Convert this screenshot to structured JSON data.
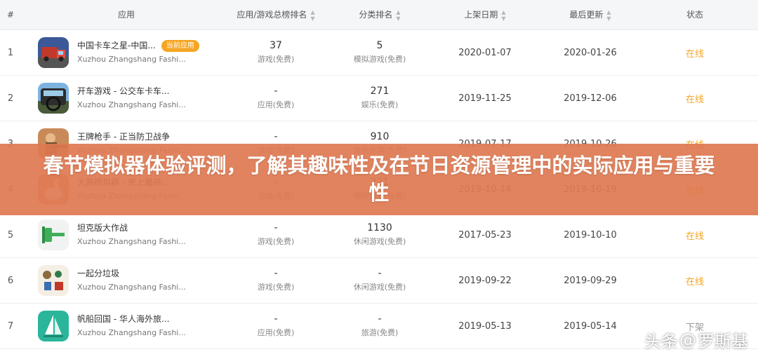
{
  "table": {
    "headers": {
      "rank": "#",
      "app": "应用",
      "total_rank": "应用/游戏总榜排名",
      "category_rank": "分类排名",
      "launch_date": "上架日期",
      "last_update": "最后更新",
      "status": "状态"
    },
    "rows": [
      {
        "rank": "1",
        "name": "中国卡车之星-中国...",
        "badge": "当前应用",
        "developer": "Xuzhou Zhangshang Fashi...",
        "total": "37",
        "total_sub": "游戏(免费)",
        "cat": "5",
        "cat_sub": "模拟游戏(免费)",
        "launch": "2020-01-07",
        "update": "2020-01-26",
        "status": "在线",
        "icon": "truck-game-icon"
      },
      {
        "rank": "2",
        "name": "开车游戏 - 公交车卡车...",
        "developer": "Xuzhou Zhangshang Fashi...",
        "total": "-",
        "total_sub": "应用(免费)",
        "cat": "271",
        "cat_sub": "娱乐(免费)",
        "launch": "2019-11-25",
        "update": "2019-12-06",
        "status": "在线",
        "icon": "bus-driving-icon"
      },
      {
        "rank": "3",
        "name": "王牌枪手 - 正当防卫战争",
        "developer": "Xuzhou Zhangshang Fashi...",
        "total": "-",
        "total_sub": "游戏(免费)",
        "cat": "910",
        "cat_sub": "角色扮演(免费)",
        "launch": "2019-07-17",
        "update": "2019-10-26",
        "status": "在线",
        "icon": "shooter-game-icon"
      },
      {
        "rank": "4",
        "name": "大鹅模拟器 - 史上最搞...",
        "developer": "Xuzhou Zhangshang Fashi...",
        "total": "-",
        "total_sub": "游戏(免费)",
        "cat": "221",
        "cat_sub": "模拟游戏(免费)",
        "launch": "2019-10-14",
        "update": "2019-10-19",
        "status": "在线",
        "icon": "goose-game-icon"
      },
      {
        "rank": "5",
        "name": "坦克版大作战",
        "developer": "Xuzhou Zhangshang Fashi...",
        "total": "-",
        "total_sub": "游戏(免费)",
        "cat": "1130",
        "cat_sub": "休闲游戏(免费)",
        "launch": "2017-05-23",
        "update": "2019-10-10",
        "status": "在线",
        "icon": "tank-game-icon"
      },
      {
        "rank": "6",
        "name": "一起分垃圾",
        "developer": "Xuzhou Zhangshang Fashi...",
        "total": "-",
        "total_sub": "游戏(免费)",
        "cat": "-",
        "cat_sub": "休闲游戏(免费)",
        "launch": "2019-09-22",
        "update": "2019-09-29",
        "status": "在线",
        "icon": "garbage-sort-icon"
      },
      {
        "rank": "7",
        "name": "帆船回国 - 华人海外旅...",
        "developer": "Xuzhou Zhangshang Fashi...",
        "total": "-",
        "total_sub": "应用(免费)",
        "cat": "-",
        "cat_sub": "旅游(免费)",
        "launch": "2019-05-13",
        "update": "2019-05-14",
        "status": "下架",
        "icon": "sailboat-icon"
      }
    ]
  },
  "overlay": {
    "title": "春节模拟器体验评测，了解其趣味性及在节日资源管理中的实际应用与重要性"
  },
  "watermark": {
    "prefix": "头条",
    "at": "@",
    "name": "罗斯基"
  },
  "colors": {
    "status_online": "#f5a623",
    "badge": "#f5a623",
    "banner": "#de7a52"
  }
}
